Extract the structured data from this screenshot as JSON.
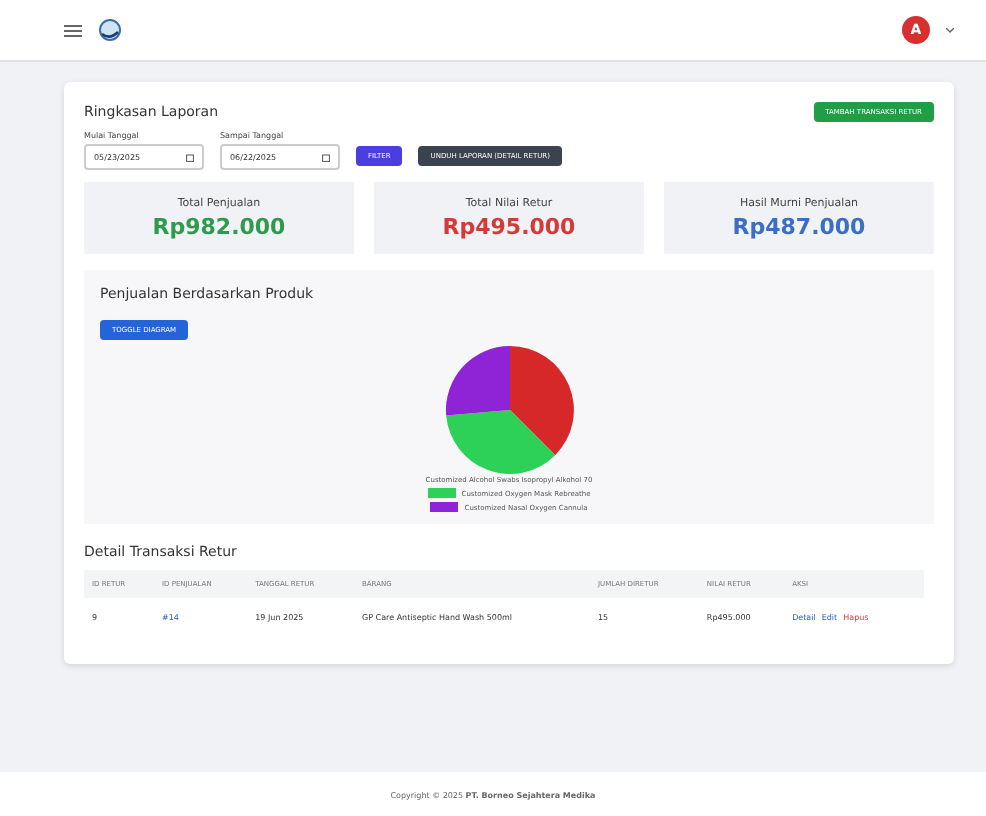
{
  "header": {
    "avatar": "A"
  },
  "summary": {
    "title": "Ringkasan Laporan",
    "add_button": "TAMBAH TRANSAKSI RETUR",
    "start": {
      "label": "Mulai Tanggal",
      "value": "05/23/2025"
    },
    "end": {
      "label": "Sampai Tanggal",
      "value": "06/22/2025"
    },
    "filter_button": "FILTER",
    "download_button": "UNDUH LAPORAN (DETAIL RETUR)",
    "stats": [
      {
        "label": "Total Penjualan",
        "value": "Rp982.000",
        "color": "#2e9a4e"
      },
      {
        "label": "Total Nilai Retur",
        "value": "Rp495.000",
        "color": "#d33a3a"
      },
      {
        "label": "Hasil Murni Penjualan",
        "value": "Rp487.000",
        "color": "#3a6fc4"
      }
    ]
  },
  "products": {
    "title": "Penjualan Berdasarkan Produk",
    "toggle_button": "TOGGLE DIAGRAM",
    "legend": [
      {
        "label": "Customized Alcohol Swabs Isopropyl Alkohol 70"
      },
      {
        "label": "Customized Oxygen Mask Rebreathe",
        "color": "#2ed158"
      },
      {
        "label": "Customized Nasal Oxygen Cannula",
        "color": "#8e24d6"
      }
    ]
  },
  "detail": {
    "title": "Detail Transaksi Retur",
    "columns": [
      "ID RETUR",
      "ID PENJUALAN",
      "TANGGAL RETUR",
      "BARANG",
      "JUMLAH DIRETUR",
      "NILAI RETUR",
      "AKSI"
    ],
    "rows": [
      {
        "cells": [
          "9",
          "#14",
          "19 Jun 2025",
          "GP Care Antiseptic Hand Wash 500ml",
          "15",
          "Rp495.000"
        ],
        "actions": [
          "Detail",
          "Edit",
          "Hapus"
        ]
      }
    ]
  },
  "footer": {
    "text": "Copyright © 2025 **PT. Borneo Sejahtera Medika**"
  }
}
